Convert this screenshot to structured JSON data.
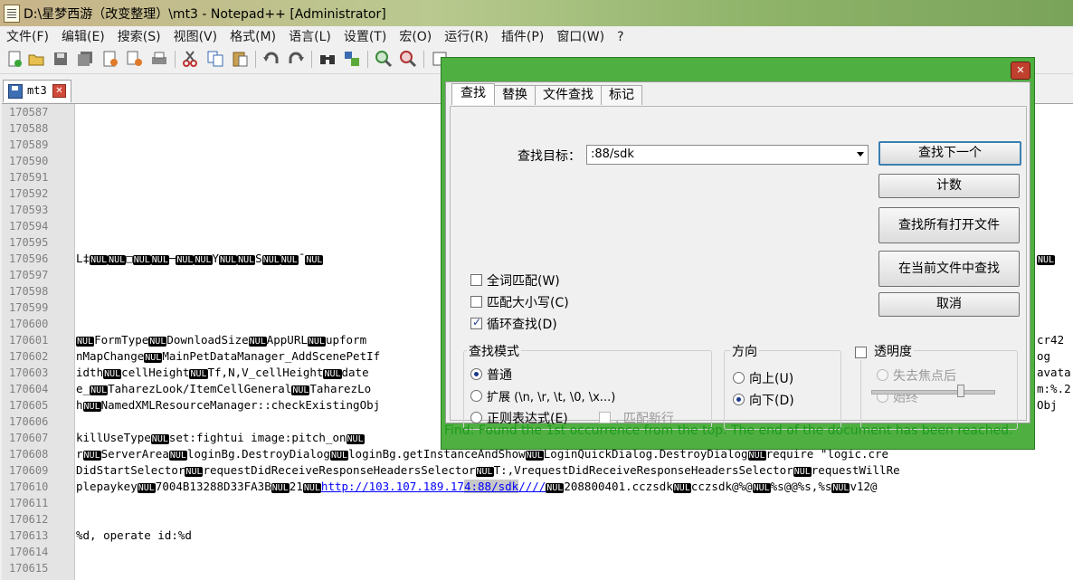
{
  "window": {
    "title": "D:\\星梦西游（改变整理）\\mt3 - Notepad++ [Administrator]"
  },
  "menu": [
    "文件(F)",
    "编辑(E)",
    "搜索(S)",
    "视图(V)",
    "格式(M)",
    "语言(L)",
    "设置(T)",
    "宏(O)",
    "运行(R)",
    "插件(P)",
    "窗口(W)",
    "?"
  ],
  "tab": {
    "name": "mt3"
  },
  "editor": {
    "line_numbers": [
      "170587",
      "170588",
      "170589",
      "170590",
      "170591",
      "170592",
      "170593",
      "170594",
      "170595",
      "170596",
      "170597",
      "170598",
      "170599",
      "170600",
      "170601",
      "170602",
      "170603",
      "170604",
      "170605",
      "170606",
      "170607",
      "170608",
      "170609",
      "170610",
      "170611",
      "170612",
      "170613",
      "170614",
      "170615"
    ],
    "nul": "NUL",
    "code": {
      "l170596": "L‡",
      "l170601": "FormType",
      "l170601b": "DownloadSize",
      "l170601c": "AppURL",
      "l170601d": "upform",
      "l170602": "nMapChange",
      "l170602b": "MainPetDataManager_AddScenePetIf",
      "l170603": "idth",
      "l170603b": "cellHeight",
      "l170603c": "Tf,N,V_cellHeight",
      "l170603d": "date",
      "l170604": "e_",
      "l170604b": "TaharezLook/ItemCellGeneral",
      "l170604c": "TaharezLo",
      "l170605": "h",
      "l170605b": "NamedXMLResourceManager::checkExistingObj",
      "l170607": "killUseType",
      "l170607b": "set:fightui image:pitch_on",
      "l170608": "r",
      "l170608b": "ServerArea",
      "l170608c": "loginBg.DestroyDialog",
      "l170608d": "loginBg.getInstanceAndShow",
      "l170608e": "LoginQuickDialog.DestroyDialog",
      "l170608f": "require \"logic.cre",
      "l170609": "DidStartSelector",
      "l170609b": "requestDidReceiveResponseHeadersSelector",
      "l170609c": "T:,VrequestDidReceiveResponseHeadersSelector",
      "l170609d": "requestWillRe",
      "l170610": "plepaykey",
      "l170610b": "7004B13288D33FA3B",
      "l170610c": "21",
      "l170610d": "http://103.107.189.17",
      "l170610e": "4:88/sdk",
      "l170610f": "////",
      "l170610g": "208800401.cczsdk",
      "l170610h": "cczsdk@%@",
      "l170610i": "%s@@%s,%s",
      "l170610j": "v12@",
      "l170613": "%d, operate id:%d",
      "right_a": "cr42",
      "right_b": "og",
      "right_c": "avata",
      "right_d": "m:%.2",
      "right_e": "Obj"
    }
  },
  "dialog": {
    "tabs": [
      "查找",
      "替换",
      "文件查找",
      "标记"
    ],
    "find_label": "查找目标：",
    "find_value": ":88/sdk",
    "buttons": [
      "查找下一个",
      "计数",
      "查找所有打开文件",
      "在当前文件中查找",
      "取消"
    ],
    "options": [
      {
        "label": "全词匹配(W)",
        "checked": false
      },
      {
        "label": "匹配大小写(C)",
        "checked": false
      },
      {
        "label": "循环查找(D)",
        "checked": true
      }
    ],
    "search_mode": {
      "title": "查找模式",
      "items": [
        "普通",
        "扩展 (\\n, \\r, \\t, \\0, \\x...)",
        "正则表达式(E)"
      ],
      "selected": 0,
      "newline_label": ". 匹配新行"
    },
    "direction": {
      "title": "方向",
      "items": [
        "向上(U)",
        "向下(D)"
      ],
      "selected": 1
    },
    "transparency": {
      "title": "透明度",
      "items": [
        "失去焦点后",
        "始终"
      ]
    },
    "status": "Find: Found the 1st occurrence from the top. The end of the document has been reached."
  }
}
